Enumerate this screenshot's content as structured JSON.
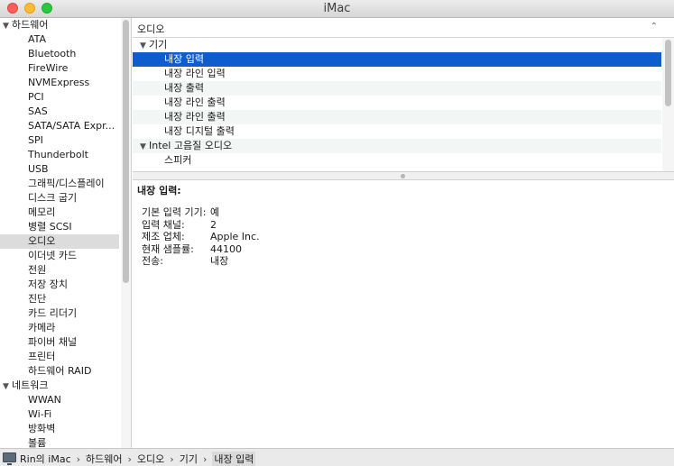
{
  "window": {
    "title": "iMac"
  },
  "sidebar": {
    "sections": [
      {
        "label": "하드웨어",
        "items": [
          "ATA",
          "Bluetooth",
          "FireWire",
          "NVMExpress",
          "PCI",
          "SAS",
          "SATA/SATA Expr...",
          "SPI",
          "Thunderbolt",
          "USB",
          "그래픽/디스플레이",
          "디스크 굽기",
          "메모리",
          "병렬 SCSI",
          "오디오",
          "이더넷 카드",
          "전원",
          "저장 장치",
          "진단",
          "카드 리더기",
          "카메라",
          "파이버 채널",
          "프린터",
          "하드웨어 RAID"
        ]
      },
      {
        "label": "네트워크",
        "items": [
          "WWAN",
          "Wi-Fi",
          "방화벽",
          "볼륨"
        ]
      }
    ],
    "selected": "오디오"
  },
  "upper": {
    "column_title": "오디오",
    "sort_icon": "chevron-up-icon",
    "groups": [
      {
        "label": "기기",
        "items": [
          "내장 입력",
          "내장 라인 입력",
          "내장 출력",
          "내장 라인 출력",
          "내장 라인 출력",
          "내장 디지털 출력"
        ]
      },
      {
        "label": "Intel 고음질 오디오",
        "items": [
          "스피커"
        ]
      }
    ],
    "selected_item": "내장 입력"
  },
  "detail": {
    "title": "내장 입력:",
    "rows": [
      {
        "key": "기본 입력 기기:",
        "value": "예"
      },
      {
        "key": "입력 채널:",
        "value": "2"
      },
      {
        "key": "제조 업체:",
        "value": "Apple Inc."
      },
      {
        "key": "현재 샘플률:",
        "value": "44100"
      },
      {
        "key": "전송:",
        "value": "내장"
      }
    ]
  },
  "pathbar": {
    "computer_icon": "imac-icon",
    "crumbs": [
      "Rin의 iMac",
      "하드웨어",
      "오디오",
      "기기",
      "내장 입력"
    ]
  }
}
